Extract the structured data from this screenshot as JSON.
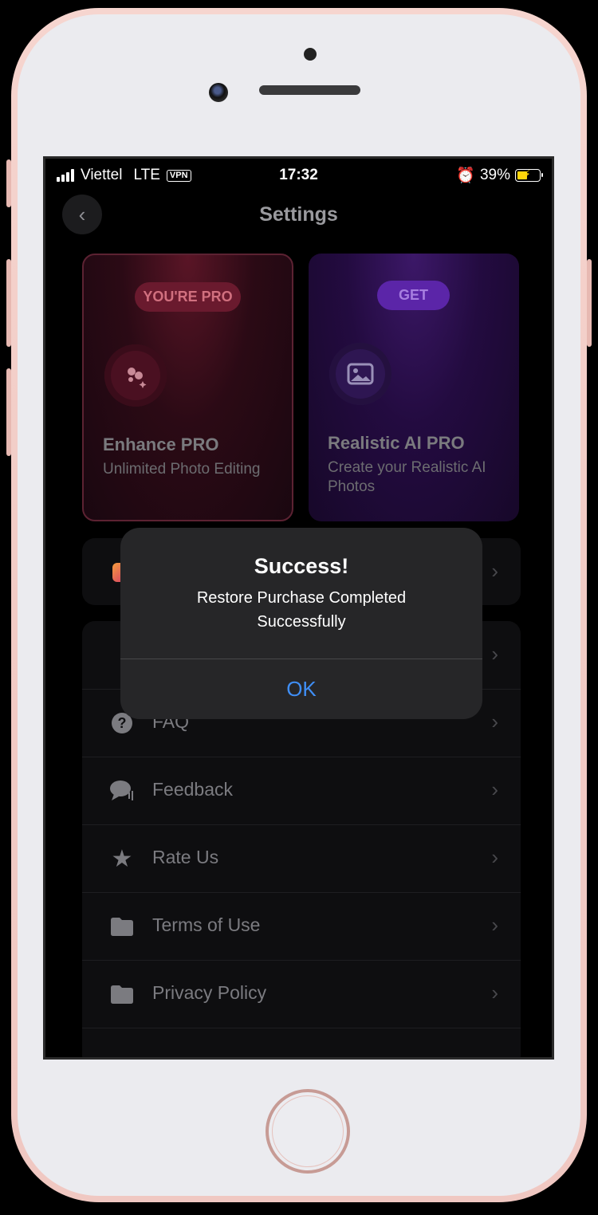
{
  "status_bar": {
    "carrier": "Viettel",
    "network": "LTE",
    "vpn": "VPN",
    "time": "17:32",
    "battery": "39%"
  },
  "nav": {
    "title": "Settings"
  },
  "cards": [
    {
      "badge": "YOU'RE PRO",
      "title": "Enhance PRO",
      "subtitle": "Unlimited Photo Editing",
      "accent": "#6a1a2e"
    },
    {
      "badge": "GET",
      "title": "Realistic AI PRO",
      "subtitle": "Create your Realistic AI Photos",
      "accent": "#5b25a8"
    }
  ],
  "settings": {
    "items": [
      {
        "label": "FAQ",
        "icon": "question-icon"
      },
      {
        "label": "Feedback",
        "icon": "chat-icon"
      },
      {
        "label": "Rate Us",
        "icon": "star-icon"
      },
      {
        "label": "Terms of Use",
        "icon": "folder-icon"
      },
      {
        "label": "Privacy Policy",
        "icon": "folder-icon"
      }
    ]
  },
  "alert": {
    "title": "Success!",
    "message": "Restore Purchase Completed Successfully",
    "ok_label": "OK",
    "ok_color": "#3f8ef5"
  }
}
